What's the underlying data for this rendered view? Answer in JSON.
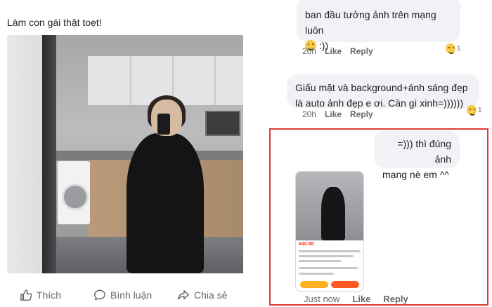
{
  "post": {
    "caption": "Làm con gái thật toẹt!",
    "actions": {
      "like_label": "Thích",
      "comment_label": "Bình luận",
      "share_label": "Chia sẻ"
    }
  },
  "comments": [
    {
      "text_line1": "ban đầu tưởng ảnh trên mạng luôn",
      "text_line2": ":))",
      "time": "20h",
      "like": "Like",
      "reply": "Reply",
      "reaction_count": "1"
    },
    {
      "text_line1": "Giấu mặt và background+ánh sáng đẹp",
      "text_line2": "là auto ảnh đẹp e ơi. Cần gì xinh=))))))",
      "time": "20h",
      "like": "Like",
      "reply": "Reply",
      "reaction_count": "1"
    },
    {
      "text_line1": "=))) thì đúng ảnh",
      "text_line2": "mạng nè em ^^",
      "time": "Just now",
      "like": "Like",
      "reply": "Reply"
    }
  ],
  "thumbnail": {
    "price": "¥40.98"
  },
  "colors": {
    "highlight": "#e03b35",
    "meta_text": "#65676b",
    "bubble_bg": "#f0f2f5"
  }
}
